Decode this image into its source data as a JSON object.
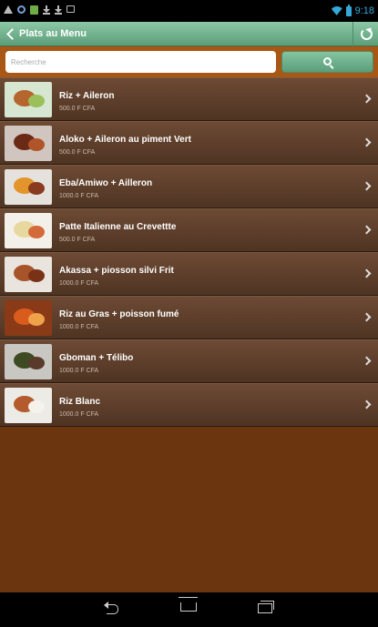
{
  "status_bar": {
    "time": "9:18",
    "left_icons": [
      "warning-icon",
      "google-icon",
      "book-icon",
      "download-icon",
      "download-icon",
      "copy-icon"
    ],
    "right_icons": [
      "wifi-icon",
      "battery-icon"
    ],
    "accent": "#35a7d8"
  },
  "action_bar": {
    "title": "Plats au Menu",
    "back_icon": "chevron-left-icon",
    "refresh_icon": "refresh-icon",
    "color": "#6fae8a"
  },
  "search": {
    "placeholder": "Recherche",
    "value": "",
    "button_icon": "search-icon",
    "bar_color": "#a85714"
  },
  "dishes": [
    {
      "name": "Riz + Aileron",
      "price": "500.0 F CFA",
      "thumb": [
        "#d6e6d0",
        "#b5652e",
        "#9bbf5a"
      ]
    },
    {
      "name": "Aloko + Aileron au piment Vert",
      "price": "500.0 F CFA",
      "thumb": [
        "#d0c6bf",
        "#6a2a16",
        "#b0552a"
      ]
    },
    {
      "name": "Eba/Amiwo + Ailleron",
      "price": "1000.0 F CFA",
      "thumb": [
        "#e5e1dd",
        "#e3952c",
        "#8a3a1e"
      ]
    },
    {
      "name": "Patte Italienne au Crevettte",
      "price": "500.0 F CFA",
      "thumb": [
        "#f2f0e8",
        "#e7d8a0",
        "#d26a3a"
      ]
    },
    {
      "name": "Akassa + piosson silvi Frit",
      "price": "1000.0 F CFA",
      "thumb": [
        "#e9e4de",
        "#a8542a",
        "#7a3217"
      ]
    },
    {
      "name": "Riz au Gras + poisson fumé",
      "price": "1000.0 F CFA",
      "thumb": [
        "#8b3a18",
        "#d95c1e",
        "#f0a24a"
      ]
    },
    {
      "name": "Gboman + Télibo",
      "price": "1000.0 F CFA",
      "thumb": [
        "#c9c7c2",
        "#3e4a22",
        "#5a3a2a"
      ]
    },
    {
      "name": "Riz Blanc",
      "price": "1000.0 F CFA",
      "thumb": [
        "#ecebe6",
        "#b45a2c",
        "#f4f2ea"
      ]
    }
  ],
  "nav_bar": {
    "icons": [
      "back-icon",
      "home-icon",
      "recent-apps-icon"
    ]
  }
}
